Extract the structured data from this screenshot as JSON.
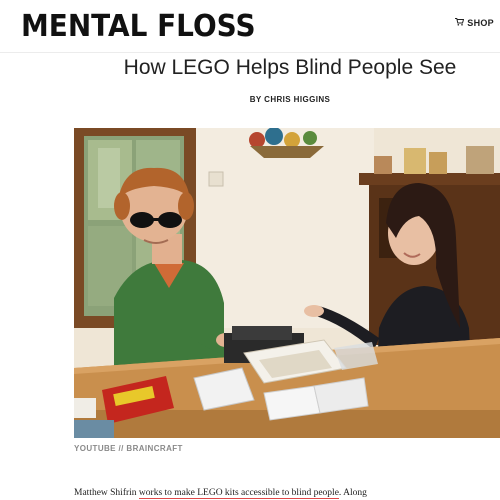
{
  "header": {
    "logo_text": "MENTAL FLOSS",
    "shop_label": "SHOP",
    "shop_icon": "cart-icon"
  },
  "article": {
    "title": "How LEGO Helps Blind People See",
    "byline": "BY CHRIS HIGGINS",
    "image_alt": "Matthew Shifrin and a woman at a wooden table with LEGO kits",
    "image_credit": "YOUTUBE // BRAINCRAFT",
    "body_start": "Matthew Shifrin ",
    "body_link": "works to make LEGO kits accessible to blind people",
    "body_end": ". Along"
  },
  "colors": {
    "link_underline": "#e04848",
    "wall": "#efe6d6",
    "table": "#c98f4d"
  }
}
